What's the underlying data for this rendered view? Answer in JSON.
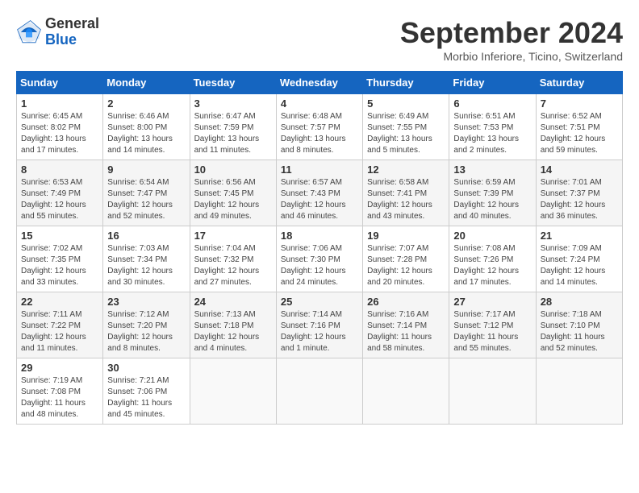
{
  "header": {
    "logo_general": "General",
    "logo_blue": "Blue",
    "month_title": "September 2024",
    "location": "Morbio Inferiore, Ticino, Switzerland"
  },
  "columns": [
    "Sunday",
    "Monday",
    "Tuesday",
    "Wednesday",
    "Thursday",
    "Friday",
    "Saturday"
  ],
  "weeks": [
    [
      {
        "day": "1",
        "info": "Sunrise: 6:45 AM\nSunset: 8:02 PM\nDaylight: 13 hours\nand 17 minutes."
      },
      {
        "day": "2",
        "info": "Sunrise: 6:46 AM\nSunset: 8:00 PM\nDaylight: 13 hours\nand 14 minutes."
      },
      {
        "day": "3",
        "info": "Sunrise: 6:47 AM\nSunset: 7:59 PM\nDaylight: 13 hours\nand 11 minutes."
      },
      {
        "day": "4",
        "info": "Sunrise: 6:48 AM\nSunset: 7:57 PM\nDaylight: 13 hours\nand 8 minutes."
      },
      {
        "day": "5",
        "info": "Sunrise: 6:49 AM\nSunset: 7:55 PM\nDaylight: 13 hours\nand 5 minutes."
      },
      {
        "day": "6",
        "info": "Sunrise: 6:51 AM\nSunset: 7:53 PM\nDaylight: 13 hours\nand 2 minutes."
      },
      {
        "day": "7",
        "info": "Sunrise: 6:52 AM\nSunset: 7:51 PM\nDaylight: 12 hours\nand 59 minutes."
      }
    ],
    [
      {
        "day": "8",
        "info": "Sunrise: 6:53 AM\nSunset: 7:49 PM\nDaylight: 12 hours\nand 55 minutes."
      },
      {
        "day": "9",
        "info": "Sunrise: 6:54 AM\nSunset: 7:47 PM\nDaylight: 12 hours\nand 52 minutes."
      },
      {
        "day": "10",
        "info": "Sunrise: 6:56 AM\nSunset: 7:45 PM\nDaylight: 12 hours\nand 49 minutes."
      },
      {
        "day": "11",
        "info": "Sunrise: 6:57 AM\nSunset: 7:43 PM\nDaylight: 12 hours\nand 46 minutes."
      },
      {
        "day": "12",
        "info": "Sunrise: 6:58 AM\nSunset: 7:41 PM\nDaylight: 12 hours\nand 43 minutes."
      },
      {
        "day": "13",
        "info": "Sunrise: 6:59 AM\nSunset: 7:39 PM\nDaylight: 12 hours\nand 40 minutes."
      },
      {
        "day": "14",
        "info": "Sunrise: 7:01 AM\nSunset: 7:37 PM\nDaylight: 12 hours\nand 36 minutes."
      }
    ],
    [
      {
        "day": "15",
        "info": "Sunrise: 7:02 AM\nSunset: 7:35 PM\nDaylight: 12 hours\nand 33 minutes."
      },
      {
        "day": "16",
        "info": "Sunrise: 7:03 AM\nSunset: 7:34 PM\nDaylight: 12 hours\nand 30 minutes."
      },
      {
        "day": "17",
        "info": "Sunrise: 7:04 AM\nSunset: 7:32 PM\nDaylight: 12 hours\nand 27 minutes."
      },
      {
        "day": "18",
        "info": "Sunrise: 7:06 AM\nSunset: 7:30 PM\nDaylight: 12 hours\nand 24 minutes."
      },
      {
        "day": "19",
        "info": "Sunrise: 7:07 AM\nSunset: 7:28 PM\nDaylight: 12 hours\nand 20 minutes."
      },
      {
        "day": "20",
        "info": "Sunrise: 7:08 AM\nSunset: 7:26 PM\nDaylight: 12 hours\nand 17 minutes."
      },
      {
        "day": "21",
        "info": "Sunrise: 7:09 AM\nSunset: 7:24 PM\nDaylight: 12 hours\nand 14 minutes."
      }
    ],
    [
      {
        "day": "22",
        "info": "Sunrise: 7:11 AM\nSunset: 7:22 PM\nDaylight: 12 hours\nand 11 minutes."
      },
      {
        "day": "23",
        "info": "Sunrise: 7:12 AM\nSunset: 7:20 PM\nDaylight: 12 hours\nand 8 minutes."
      },
      {
        "day": "24",
        "info": "Sunrise: 7:13 AM\nSunset: 7:18 PM\nDaylight: 12 hours\nand 4 minutes."
      },
      {
        "day": "25",
        "info": "Sunrise: 7:14 AM\nSunset: 7:16 PM\nDaylight: 12 hours\nand 1 minute."
      },
      {
        "day": "26",
        "info": "Sunrise: 7:16 AM\nSunset: 7:14 PM\nDaylight: 11 hours\nand 58 minutes."
      },
      {
        "day": "27",
        "info": "Sunrise: 7:17 AM\nSunset: 7:12 PM\nDaylight: 11 hours\nand 55 minutes."
      },
      {
        "day": "28",
        "info": "Sunrise: 7:18 AM\nSunset: 7:10 PM\nDaylight: 11 hours\nand 52 minutes."
      }
    ],
    [
      {
        "day": "29",
        "info": "Sunrise: 7:19 AM\nSunset: 7:08 PM\nDaylight: 11 hours\nand 48 minutes."
      },
      {
        "day": "30",
        "info": "Sunrise: 7:21 AM\nSunset: 7:06 PM\nDaylight: 11 hours\nand 45 minutes."
      },
      {
        "day": "",
        "info": ""
      },
      {
        "day": "",
        "info": ""
      },
      {
        "day": "",
        "info": ""
      },
      {
        "day": "",
        "info": ""
      },
      {
        "day": "",
        "info": ""
      }
    ]
  ]
}
